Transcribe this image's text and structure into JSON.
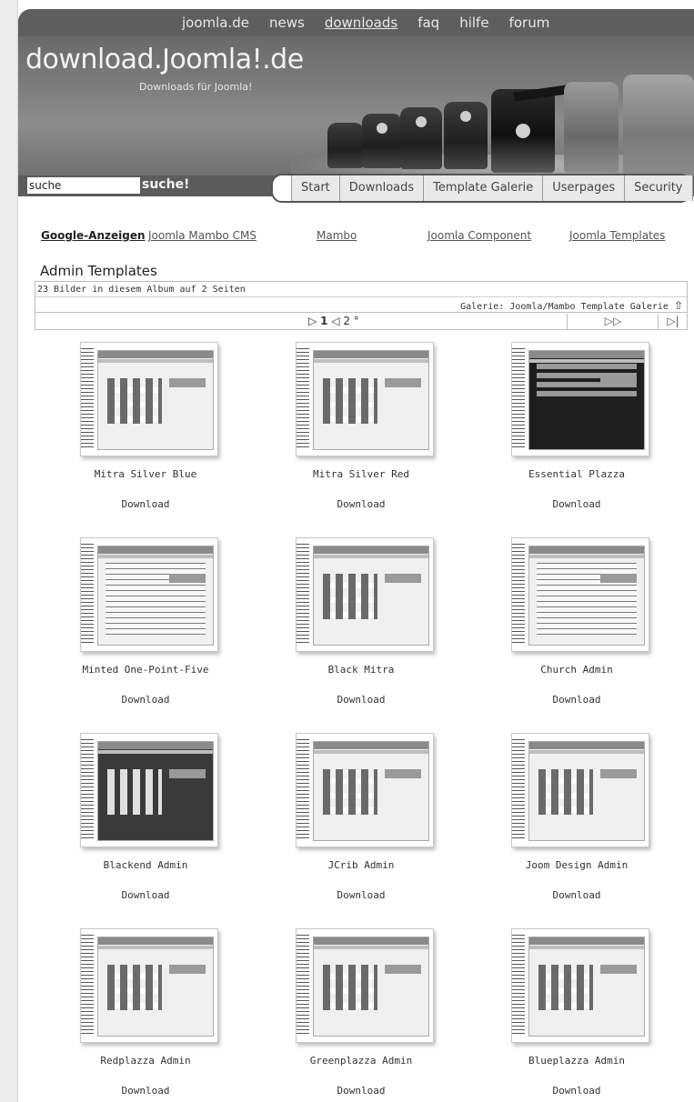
{
  "topnav": {
    "items": [
      "joomla.de",
      "news",
      "downloads",
      "faq",
      "hilfe",
      "forum"
    ],
    "active_index": 2
  },
  "brand": {
    "logo": "download.Joomla!.de",
    "tagline": "Downloads für Joomla!"
  },
  "search": {
    "value": "suche",
    "button_label": "suche!"
  },
  "tabs": [
    "Start",
    "Downloads",
    "Template Galerie",
    "Userpages",
    "Security"
  ],
  "ads": {
    "label": "Google-Anzeigen",
    "links": [
      "Joomla Mambo CMS",
      "Mambo",
      "Joomla Component",
      "Joomla Templates"
    ]
  },
  "album": {
    "title": "Admin Templates",
    "info": "23 Bilder in diesem Album auf 2 Seiten",
    "gallery_path": "Galerie: Joomla/Mambo Template Galerie",
    "up_icon": "up-arrow-icon",
    "pager": {
      "prev_symbol": "▷",
      "current": "1",
      "next_symbol": "◁",
      "other": "2",
      "more": "°"
    },
    "next_label": "▷▷",
    "last_label": "▷|"
  },
  "items": [
    {
      "title": "Mitra Silver Blue",
      "download": "Download",
      "style": "light"
    },
    {
      "title": "Mitra Silver Red",
      "download": "Download",
      "style": "light"
    },
    {
      "title": "Essential Plazza",
      "download": "Download",
      "style": "black"
    },
    {
      "title": "Minted One-Point-Five",
      "download": "Download",
      "style": "table"
    },
    {
      "title": "Black Mitra",
      "download": "Download",
      "style": "light"
    },
    {
      "title": "Church Admin",
      "download": "Download",
      "style": "table"
    },
    {
      "title": "Blackend Admin",
      "download": "Download",
      "style": "dark"
    },
    {
      "title": "JCrib Admin",
      "download": "Download",
      "style": "light"
    },
    {
      "title": "Joom Design Admin",
      "download": "Download",
      "style": "light"
    },
    {
      "title": "Redplazza Admin",
      "download": "Download",
      "style": "light"
    },
    {
      "title": "Greenplazza Admin",
      "download": "Download",
      "style": "light"
    },
    {
      "title": "Blueplazza Admin",
      "download": "Download",
      "style": "light"
    }
  ],
  "colors": {
    "header_bg": "#5a5a5a",
    "page_bg": "#ffffff",
    "tab_bg": "#e9e9e9"
  }
}
